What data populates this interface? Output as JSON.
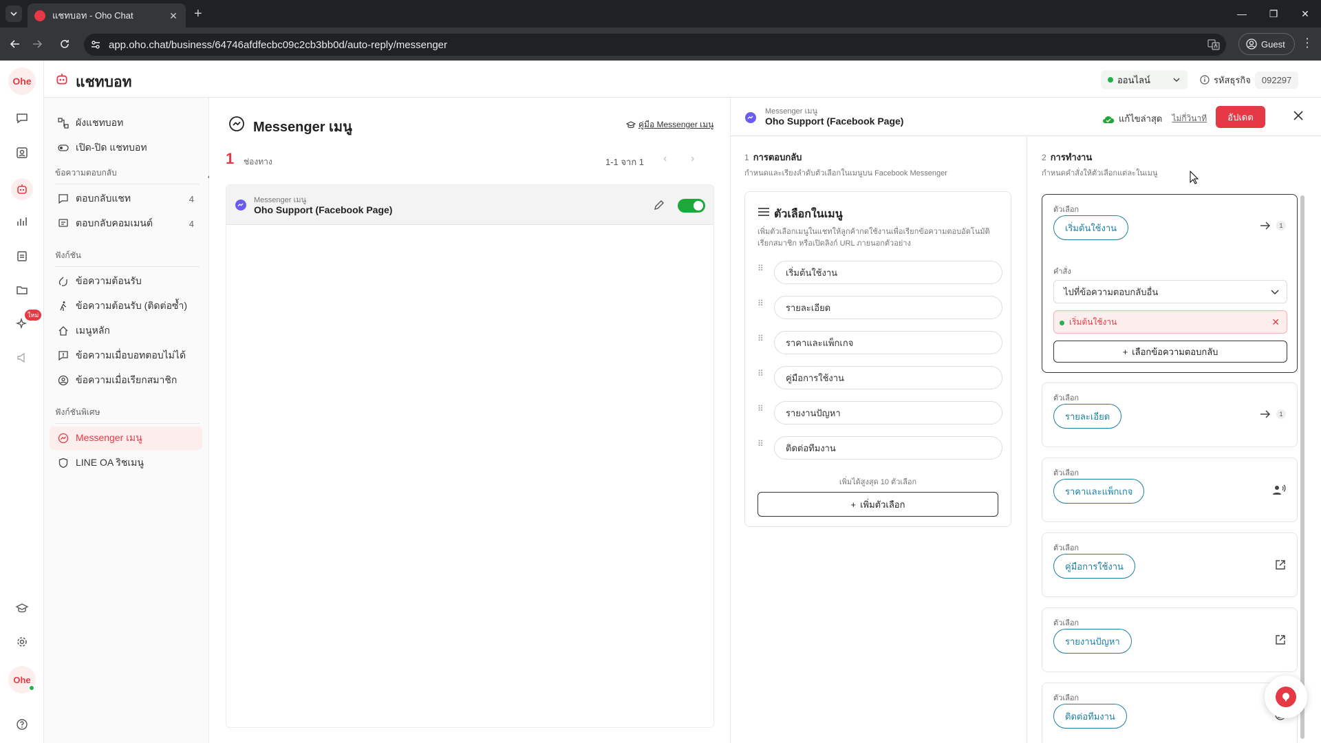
{
  "browser": {
    "tab_title": "แชทบอท - Oho Chat",
    "url": "app.oho.chat/business/64746afdfecbc09c2cb3bb0d/auto-reply/messenger",
    "profile_label": "Guest"
  },
  "rail": {
    "logo_text": "Ohe",
    "badge_new": "ใหม่",
    "avatar_text": "Ohe"
  },
  "topbar": {
    "title": "แชทบอท",
    "status": "ออนไลน์",
    "biz_label": "รหัสธุรกิจ",
    "biz_code": "092297"
  },
  "sidenav": {
    "items_top": [
      {
        "label": "ผังแชทบอท"
      },
      {
        "label": "เปิด-ปิด แชทบอท"
      }
    ],
    "section_reply": "ข้อความตอบกลับ",
    "reply_items": [
      {
        "label": "ตอบกลับแชท",
        "count": "4"
      },
      {
        "label": "ตอบกลับคอมเมนต์",
        "count": "4"
      }
    ],
    "section_func": "ฟังก์ชัน",
    "func_items": [
      {
        "label": "ข้อความต้อนรับ"
      },
      {
        "label": "ข้อความต้อนรับ (ติดต่อซ้ำ)"
      },
      {
        "label": "เมนูหลัก"
      },
      {
        "label": "ข้อความเมื่อบอทตอบไม่ได้"
      },
      {
        "label": "ข้อความเมื่อเรียกสมาชิก"
      }
    ],
    "section_special": "ฟังก์ชันพิเศษ",
    "special_items": [
      {
        "label": "Messenger เมนู"
      },
      {
        "label": "LINE OA ริชเมนู"
      }
    ]
  },
  "listpane": {
    "title": "Messenger เมนู",
    "guide_link": "คู่มือ Messenger เมนู",
    "count": "1",
    "count_label": "ช่องทาง",
    "pager": "1-1 จาก 1",
    "row": {
      "sub": "Messenger เมนู",
      "name": "Oho Support (Facebook Page)",
      "enabled": true
    }
  },
  "editor": {
    "head_sub": "Messenger เมนู",
    "head_name": "Oho Support (Facebook Page)",
    "saved_label": "แก้ไขล่าสุด",
    "saved_ago": "ไม่กี่วินาที",
    "publish_label": "อัปเดต",
    "section1": {
      "num": "1",
      "title": "การตอบกลับ",
      "desc": "กำหนดและเรียงลำดับตัวเลือกในเมนูบน Facebook Messenger"
    },
    "section2": {
      "num": "2",
      "title": "การทำงาน",
      "desc": "กำหนดคำสั่งให้ตัวเลือกแต่ละในเมนู"
    },
    "menu_card": {
      "title": "ตัวเลือกในเมนู",
      "desc": "เพิ่มตัวเลือกเมนูในแชทให้ลูกค้ากดใช้งานเพื่อเรียกข้อความตอบอัตโนมัติ เรียกสมาชิก หรือเปิดลิงก์ URL ภายนอกตัวอย่าง",
      "options": [
        "เริ่มต้นใช้งาน",
        "รายละเอียด",
        "ราคาและแพ็กเกจ",
        "คู่มือการใช้งาน",
        "รายงานปัญหา",
        "ติดต่อทีมงาน"
      ],
      "max_note": "เพิ่มได้สูงสุด 10 ตัวเลือก",
      "add_label": "เพิ่มตัวเลือก"
    },
    "actions": [
      {
        "label": "ตัวเลือก",
        "chip": "เริ่มต้นใช้งาน",
        "icon": "arrow-right-icon",
        "count": "1"
      },
      {
        "label": "ตัวเลือก",
        "chip": "รายละเอียด",
        "icon": "arrow-right-icon",
        "count": "1"
      },
      {
        "label": "ตัวเลือก",
        "chip": "ราคาและแพ็กเกจ",
        "icon": "call-member-icon"
      },
      {
        "label": "ตัวเลือก",
        "chip": "คู่มือการใช้งาน",
        "icon": "external-link-icon"
      },
      {
        "label": "ตัวเลือก",
        "chip": "รายงานปัญหา",
        "icon": "external-link-icon"
      },
      {
        "label": "ตัวเลือก",
        "chip": "ติดต่อทีมงาน",
        "icon": "user-icon"
      }
    ],
    "command": {
      "label": "คำสั่ง",
      "selected": "ไปที่ข้อความตอบกลับอื่น",
      "target": "เริ่มต้นใช้งาน",
      "add_label": "เลือกข้อความตอบกลับ"
    }
  },
  "colors": {
    "brand": "#e53945",
    "accent_link": "#1b7fa3",
    "online": "#23b14d"
  }
}
